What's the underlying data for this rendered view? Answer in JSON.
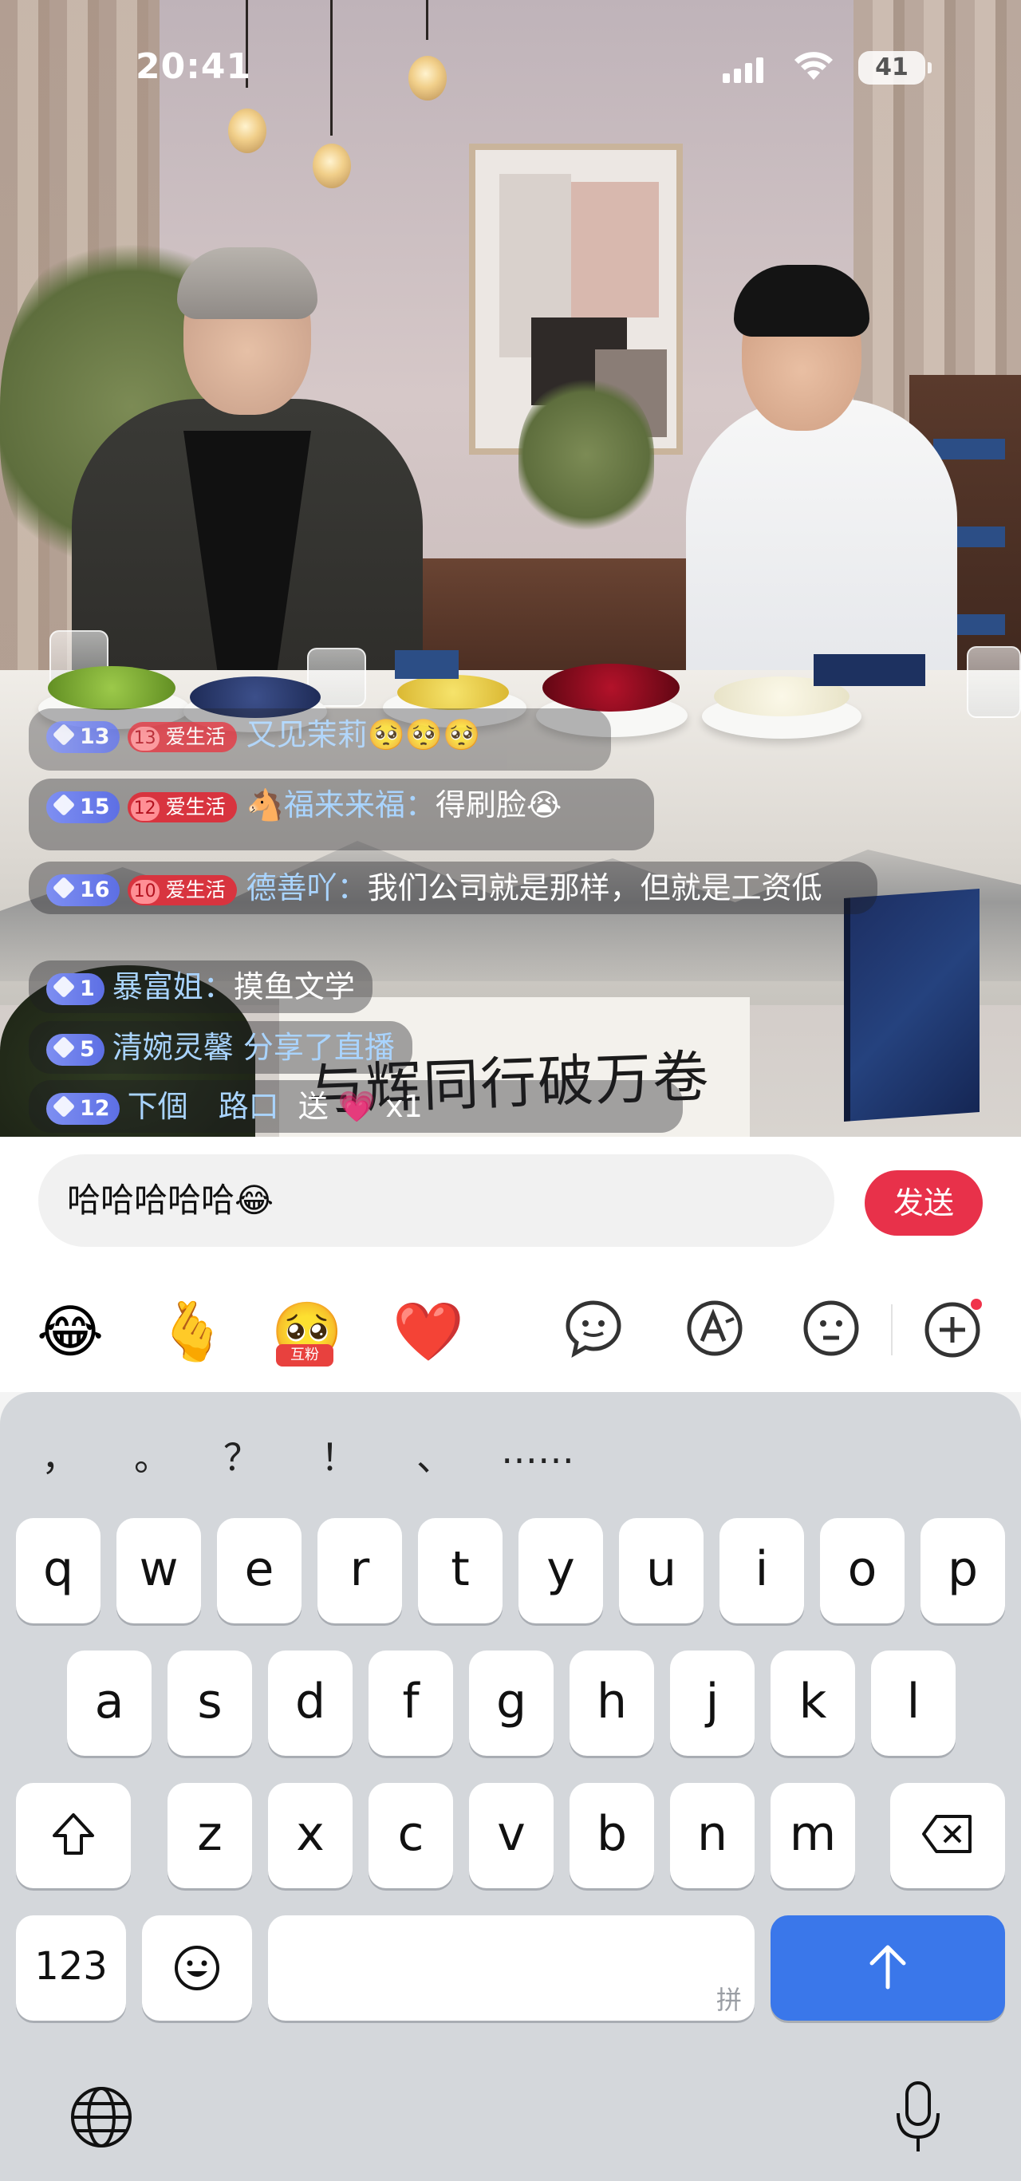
{
  "status_bar": {
    "time": "20:41",
    "battery": "41"
  },
  "comments": [
    {
      "level": "13",
      "fan_level": "13",
      "fan_club": "爱生活",
      "user": "又见茉莉",
      "text": "🥺🥺🥺"
    },
    {
      "level": "15",
      "fan_level": "12",
      "fan_club": "爱生活",
      "user": "🐴福来来福：",
      "text": "得刷脸😭"
    },
    {
      "level": "16",
      "fan_level": "10",
      "fan_club": "爱生活",
      "user": "德善吖：",
      "text": "我们公司就是那样，但就是工资低"
    },
    {
      "level": "1",
      "user": "暴富姐：",
      "text": "摸鱼文学"
    },
    {
      "level": "5",
      "user": "清婉灵馨",
      "text": "分享了直播"
    },
    {
      "level": "12",
      "user": "下個　路口",
      "text": "送 💗 x1"
    }
  ],
  "video_caption": "与辉同行破万卷",
  "input": {
    "value": "哈哈哈哈哈😂",
    "send_label": "发送"
  },
  "emoji_row": {
    "quick": [
      "😂",
      "🫰",
      "🥺",
      "❤️"
    ],
    "fan_emoji_label": "互粉",
    "tools": [
      "ai-reply-icon",
      "ai-font-icon",
      "emoji-panel-icon",
      "plus-icon"
    ]
  },
  "keyboard": {
    "punctuation": [
      "，",
      "。",
      "？",
      "！",
      "、",
      "……"
    ],
    "row1": [
      "q",
      "w",
      "e",
      "r",
      "t",
      "y",
      "u",
      "i",
      "o",
      "p"
    ],
    "row2": [
      "a",
      "s",
      "d",
      "f",
      "g",
      "h",
      "j",
      "k",
      "l"
    ],
    "row3": [
      "z",
      "x",
      "c",
      "v",
      "b",
      "n",
      "m"
    ],
    "numbers_key": "123",
    "space_hint": "拼",
    "colors": {
      "return_key": "#3a77ea",
      "send_button": "#e8314a"
    }
  }
}
